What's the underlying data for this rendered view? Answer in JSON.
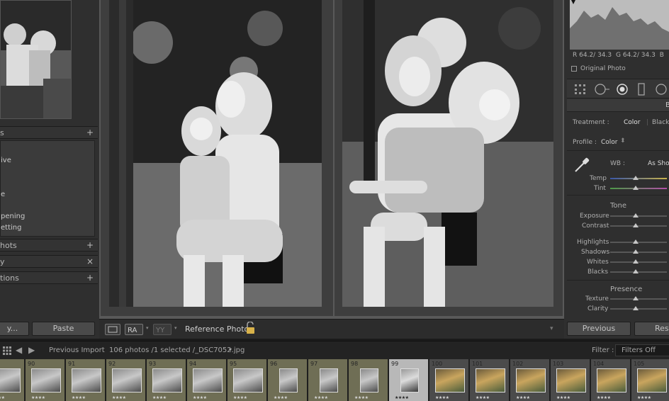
{
  "left_panel": {
    "sections": [
      {
        "label": "s",
        "glyph": "+"
      },
      {
        "label": "hots",
        "glyph": "+"
      },
      {
        "label": "y",
        "glyph": "×"
      },
      {
        "label": "tions",
        "glyph": "+"
      }
    ],
    "presets": [
      "",
      "ive",
      "",
      "",
      "",
      "e",
      "",
      "pening",
      "etting"
    ],
    "copy_button": "y...",
    "paste_button": "Paste"
  },
  "toolbar": {
    "reference_label": "Reference Photo :"
  },
  "right_panel": {
    "rgb_readout": {
      "r_label": "R",
      "r_value": "64.2/ 34.3",
      "g_label": "G",
      "g_value": "64.2/ 34.3",
      "b_label": "B"
    },
    "original_photo_label": "Original Photo",
    "panel_title": "B",
    "treatment_label": "Treatment :",
    "treatment_color": "Color",
    "treatment_bw": "Black",
    "profile_label": "Profile :",
    "profile_value": "Color",
    "wb_label": "WB :",
    "wb_value": "As Shot",
    "temp_label": "Temp",
    "tint_label": "Tint",
    "tone_title": "Tone",
    "sliders_tone": [
      "Exposure",
      "Contrast",
      "Highlights",
      "Shadows",
      "Whites",
      "Blacks"
    ],
    "presence_title": "Presence",
    "sliders_presence": [
      "Texture",
      "Clarity"
    ],
    "previous_button": "Previous",
    "reset_button": "Rese"
  },
  "filmstrip_bar": {
    "source": "Previous Import",
    "info": "106 photos /1 selected /_DSC7052.jpg",
    "filter_label": "Filter :",
    "filter_value": "Filters Off"
  },
  "filmstrip": [
    {
      "num": "",
      "stars": "★★★★",
      "style": "hl"
    },
    {
      "num": "90",
      "stars": "★★★★",
      "style": "hl"
    },
    {
      "num": "91",
      "stars": "★★★★",
      "style": "hl"
    },
    {
      "num": "92",
      "stars": "★★★★",
      "style": "hl"
    },
    {
      "num": "93",
      "stars": "★★★★",
      "style": "hl"
    },
    {
      "num": "94",
      "stars": "★★★★",
      "style": "hl"
    },
    {
      "num": "95",
      "stars": "★★★★",
      "style": "hl"
    },
    {
      "num": "96",
      "stars": "★★★★",
      "style": "hl"
    },
    {
      "num": "97",
      "stars": "★★★★",
      "style": "hl"
    },
    {
      "num": "98",
      "stars": "★★★★",
      "style": "hl"
    },
    {
      "num": "99",
      "stars": "★★★★",
      "style": "sel"
    },
    {
      "num": "100",
      "stars": "★★★★",
      "style": ""
    },
    {
      "num": "101",
      "stars": "★★★★",
      "style": ""
    },
    {
      "num": "102",
      "stars": "★★★★",
      "style": ""
    },
    {
      "num": "103",
      "stars": "★★★★",
      "style": ""
    },
    {
      "num": "104",
      "stars": "★★★★",
      "style": ""
    },
    {
      "num": "105",
      "stars": "★★★★",
      "style": ""
    }
  ]
}
